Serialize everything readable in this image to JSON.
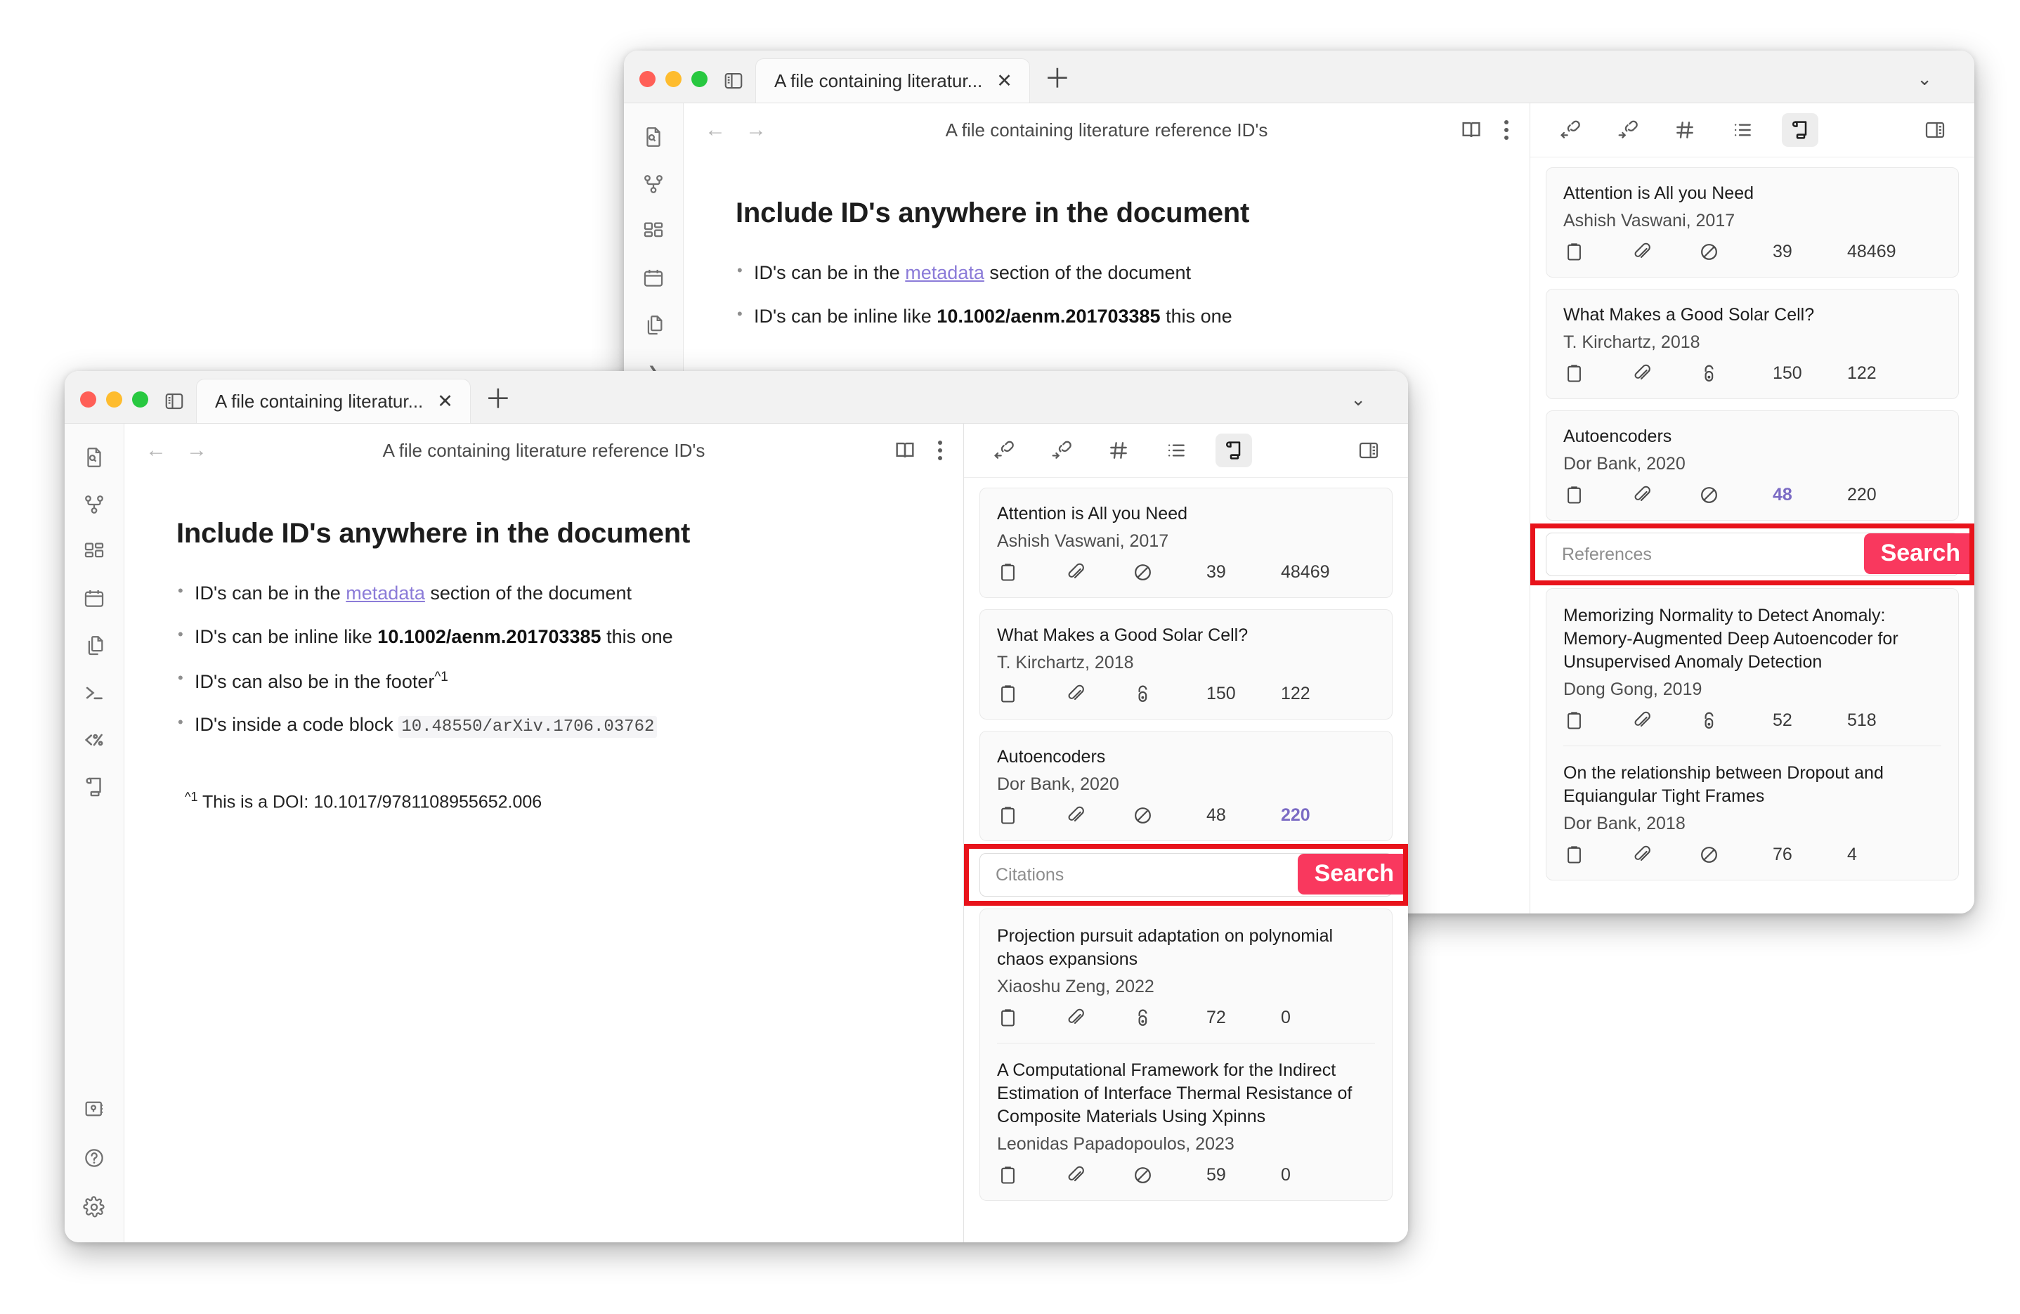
{
  "windows": {
    "back": {
      "tab_label": "A file containing literatur...",
      "doc_title": "A file containing literature reference ID's",
      "panel_search": {
        "placeholder": "References",
        "button_label": "Search"
      },
      "refs": [
        {
          "title": "Attention is All you Need",
          "author": "Ashish Vaswani, 2017",
          "access": "blocked",
          "n1": "39",
          "n2": "48469",
          "hl": "none"
        },
        {
          "title": "What Makes a Good Solar Cell?",
          "author": "T. Kirchartz, 2018",
          "access": "open",
          "n1": "150",
          "n2": "122",
          "hl": "none"
        },
        {
          "title": "Autoencoders",
          "author": "Dor Bank, 2020",
          "access": "blocked",
          "n1": "48",
          "n2": "220",
          "hl": "n1"
        }
      ],
      "refs_below": [
        {
          "title": "Memorizing Normality to Detect Anomaly: Memory-Augmented Deep Autoencoder for Unsupervised Anomaly Detection",
          "author": "Dong Gong, 2019",
          "access": "open",
          "n1": "52",
          "n2": "518",
          "hl": "none"
        },
        {
          "title": "On the relationship between Dropout and Equiangular Tight Frames",
          "author": "Dor Bank, 2018",
          "access": "blocked",
          "n1": "76",
          "n2": "4",
          "hl": "none"
        }
      ]
    },
    "front": {
      "tab_label": "A file containing literatur...",
      "doc_title": "A file containing literature reference ID's",
      "document": {
        "heading": "Include ID's anywhere in the document",
        "bullets": [
          {
            "pre": "ID's can be in the ",
            "link": "metadata",
            "post": " section of the document"
          },
          {
            "pre": "ID's can be inline  like ",
            "bold": "10.1002/aenm.201703385",
            "post": "  this one"
          },
          {
            "pre": "ID's can also be in the footer",
            "sup": "^1"
          },
          {
            "pre": "ID's inside a code block ",
            "code": "10.48550/arXiv.1706.03762"
          }
        ],
        "footnote_sup": "^1",
        "footnote_text": " This is a DOI: 10.1017/9781108955652.006"
      },
      "panel_search": {
        "placeholder": "Citations",
        "button_label": "Search"
      },
      "refs": [
        {
          "title": "Attention is All you Need",
          "author": "Ashish Vaswani, 2017",
          "access": "blocked",
          "n1": "39",
          "n2": "48469",
          "hl": "none"
        },
        {
          "title": "What Makes a Good Solar Cell?",
          "author": "T. Kirchartz, 2018",
          "access": "open",
          "n1": "150",
          "n2": "122",
          "hl": "none"
        },
        {
          "title": "Autoencoders",
          "author": "Dor Bank, 2020",
          "access": "blocked",
          "n1": "48",
          "n2": "220",
          "hl": "n2"
        }
      ],
      "refs_below": [
        {
          "title": "Projection pursuit adaptation on polynomial chaos expansions",
          "author": "Xiaoshu Zeng, 2022",
          "access": "open",
          "n1": "72",
          "n2": "0",
          "hl": "none"
        },
        {
          "title": "A Computational Framework for the Indirect Estimation of Interface Thermal Resistance of Composite Materials Using Xpinns",
          "author": "Leonidas Papadopoulos, 2023",
          "access": "blocked",
          "n1": "59",
          "n2": "0",
          "hl": "none"
        }
      ]
    }
  },
  "rail": {
    "top_icons": [
      "file-search-icon",
      "graph-icon",
      "dashboard-icon",
      "calendar-icon",
      "copy-files-icon",
      "terminal-icon",
      "template-icon",
      "scroll-icon"
    ],
    "bottom_icons": [
      "vault-icon",
      "help-icon",
      "settings-icon"
    ]
  },
  "panel_toolbar": {
    "icons": [
      "link-in-icon",
      "link-out-icon",
      "hash-icon",
      "list-icon",
      "scroll-icon",
      "right-panel-icon"
    ],
    "active": "scroll-icon"
  },
  "colors": {
    "accent_pink": "#f9385e",
    "highlight_border": "#e8131b",
    "link_purple": "#8b7bd8",
    "stat_highlight": "#7b6bc4"
  }
}
